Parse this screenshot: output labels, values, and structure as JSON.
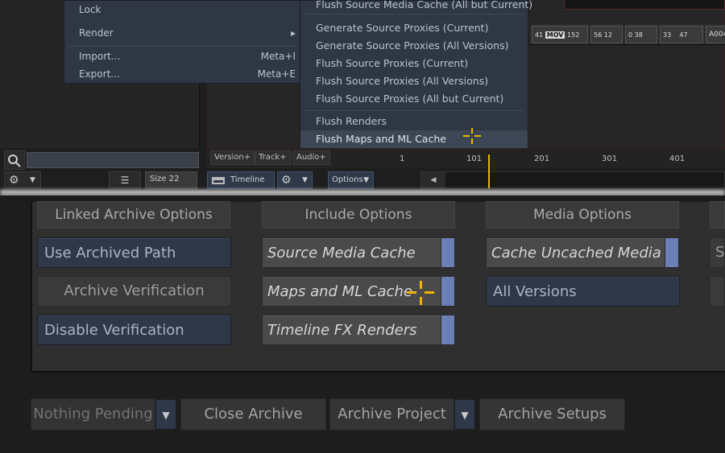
{
  "menu_left": {
    "items": [
      {
        "label": "Lock",
        "shortcut": ""
      },
      {
        "label": "Render",
        "shortcut": "▸"
      },
      {
        "label": "Import...",
        "shortcut": "Meta+I"
      },
      {
        "label": "Export...",
        "shortcut": "Meta+E"
      }
    ]
  },
  "menu_right": {
    "items": [
      {
        "label": "Flush Source Media Cache (All but Current)"
      },
      {
        "label": "Generate Source Proxies (Current)"
      },
      {
        "label": "Generate Source Proxies (All Versions)"
      },
      {
        "label": "Flush Source Proxies (Current)"
      },
      {
        "label": "Flush Source Proxies (All Versions)"
      },
      {
        "label": "Flush Source Proxies (All but Current)"
      },
      {
        "label": "Flush Renders"
      },
      {
        "label": "Flush Maps and ML Cache"
      }
    ],
    "highlighted_index": 7
  },
  "left_panel": {
    "search_placeholder": "",
    "size_label": "Size 22"
  },
  "clip_strip": {
    "clips": [
      {
        "a": "41",
        "badge": "MOV",
        "b": "152"
      },
      {
        "a": "56",
        "badge": "",
        "b": "12"
      },
      {
        "a": "0",
        "badge": "",
        "b": "38"
      },
      {
        "a": "33",
        "badge": "",
        "b": "47"
      },
      {
        "a": "A004",
        "badge": "",
        "b": ""
      }
    ]
  },
  "track_bar": {
    "buttons": [
      "Version+",
      "Track+",
      "Audio+"
    ],
    "ruler_ticks": [
      "1",
      "101",
      "201",
      "301",
      "401"
    ]
  },
  "timeline_row": {
    "timeline_label": "Timeline",
    "options_label": "Options"
  },
  "archive_panel": {
    "columns": [
      {
        "heading": "Linked Archive Options"
      },
      {
        "heading": "Include Options"
      },
      {
        "heading": "Media Options"
      }
    ],
    "linked": {
      "use_archived_path": "Use Archived Path",
      "archive_verification": "Archive Verification",
      "disable_verification": "Disable Verification"
    },
    "include": {
      "source_media_cache": "Source Media Cache",
      "maps_ml_cache": "Maps and ML Cache",
      "timeline_fx_renders": "Timeline FX Renders"
    },
    "media": {
      "cache_uncached_media": "Cache Uncached Media",
      "all_versions": "All Versions"
    },
    "partial_right": "S"
  },
  "bottom_bar": {
    "nothing_pending": "Nothing Pending",
    "close_archive": "Close Archive",
    "archive_project": "Archive Project",
    "archive_setups": "Archive Setups"
  },
  "colors": {
    "toggle_on": "#6b7fb7",
    "menu_bg": "#2f3744",
    "cursor": "#f0b400",
    "playhead": "#e2b800"
  }
}
